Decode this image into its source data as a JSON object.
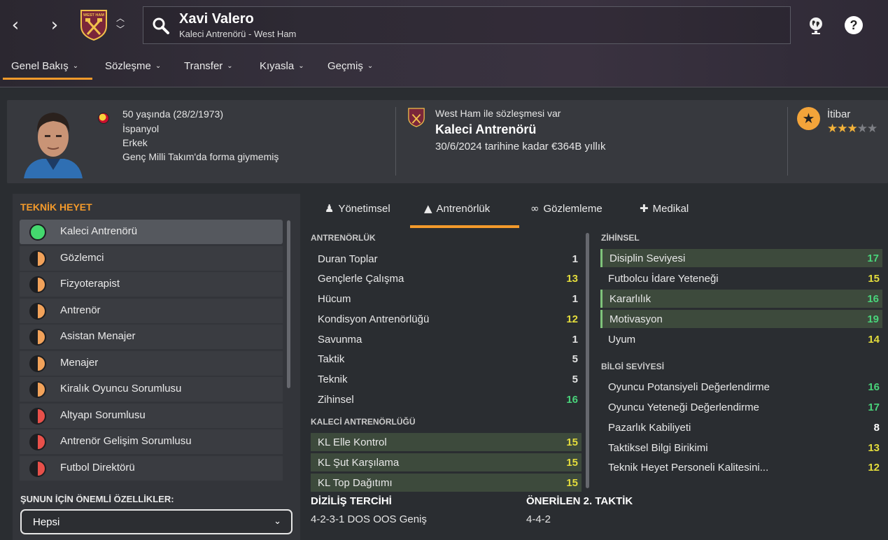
{
  "header": {
    "back_icon": "chevron-left",
    "forward_icon": "chevron-right",
    "club_crest": "west-ham-crest",
    "crest_text": "WEST HAM",
    "search": {
      "name": "Xavi Valero",
      "subtitle": "Kaleci Antrenörü - West Ham"
    },
    "right_icons": [
      "world-icon",
      "help-icon"
    ]
  },
  "menu": {
    "items": [
      "Genel Bakış",
      "Sözleşme",
      "Transfer",
      "Kıyasla",
      "Geçmiş"
    ],
    "active": 0
  },
  "profile": {
    "lines": [
      "50 yaşında (28/2/1973)",
      "İspanyol",
      "Erkek",
      "Genç Milli Takım'da forma giymemiş"
    ],
    "contract_text": "West Ham ile sözleşmesi var",
    "role": "Kaleci Antrenörü",
    "contract_value": "30/6/2024 tarihine kadar €364B yıllık",
    "reputation_label": "İtibar",
    "reputation_stars": 3
  },
  "staff_panel": {
    "title": "TEKNİK HEYET",
    "items": [
      {
        "label": "Kaleci Antrenörü",
        "status": "green"
      },
      {
        "label": "Gözlemci",
        "status": "orange"
      },
      {
        "label": "Fizyoterapist",
        "status": "orange"
      },
      {
        "label": "Antrenör",
        "status": "orange"
      },
      {
        "label": "Asistan Menajer",
        "status": "orange"
      },
      {
        "label": "Menajer",
        "status": "orange"
      },
      {
        "label": "Kiralık Oyuncu Sorumlusu",
        "status": "orange"
      },
      {
        "label": "Altyapı Sorumlusu",
        "status": "red"
      },
      {
        "label": "Antrenör Gelişim Sorumlusu",
        "status": "red"
      },
      {
        "label": "Futbol Direktörü",
        "status": "red"
      }
    ],
    "select_label": "ŞUNUN İÇİN ÖNEMLİ ÖZELLİKLER:",
    "select_value": "Hepsi"
  },
  "tabs": [
    {
      "label": "Yönetimsel",
      "icon": "person-icon"
    },
    {
      "label": "Antrenörlük",
      "icon": "cone-icon"
    },
    {
      "label": "Gözlemleme",
      "icon": "binoculars-icon"
    },
    {
      "label": "Medikal",
      "icon": "medkit-icon"
    }
  ],
  "coaching": {
    "title": "ANTRENÖRLÜK",
    "attrs": [
      {
        "name": "Duran Toplar",
        "value": "1"
      },
      {
        "name": "Gençlerle Çalışma",
        "value": "13"
      },
      {
        "name": "Hücum",
        "value": "1"
      },
      {
        "name": "Kondisyon Antrenörlüğü",
        "value": "12"
      },
      {
        "name": "Savunma",
        "value": "1"
      },
      {
        "name": "Taktik",
        "value": "5"
      },
      {
        "name": "Teknik",
        "value": "5"
      },
      {
        "name": "Zihinsel",
        "value": "16"
      }
    ]
  },
  "gk_coaching": {
    "title": "KALECİ ANTRENÖRLÜĞÜ",
    "attrs": [
      {
        "name": "KL Elle Kontrol",
        "value": "15"
      },
      {
        "name": "KL Şut Karşılama",
        "value": "15"
      },
      {
        "name": "KL Top Dağıtımı",
        "value": "15"
      }
    ]
  },
  "mental": {
    "title": "ZİHİNSEL",
    "attrs": [
      {
        "name": "Disiplin Seviyesi",
        "value": "17"
      },
      {
        "name": "Futbolcu İdare Yeteneği",
        "value": "15"
      },
      {
        "name": "Kararlılık",
        "value": "16"
      },
      {
        "name": "Motivasyon",
        "value": "19"
      },
      {
        "name": "Uyum",
        "value": "14"
      }
    ]
  },
  "knowledge": {
    "title": "BİLGİ SEVİYESİ",
    "attrs": [
      {
        "name": "Oyuncu Potansiyeli Değerlendirme",
        "value": "16"
      },
      {
        "name": "Oyuncu Yeteneği Değerlendirme",
        "value": "17"
      },
      {
        "name": "Pazarlık Kabiliyeti",
        "value": "8"
      },
      {
        "name": "Taktiksel Bilgi Birikimi",
        "value": "13"
      },
      {
        "name": "Teknik Heyet Personeli Kalitesini...",
        "value": "12"
      }
    ]
  },
  "footer": {
    "formation_title": "DİZİLİŞ TERCİHİ",
    "formation_value": "4-2-3-1 DOS OOS Geniş",
    "tactic_title": "ÖNERİLEN 2. TAKTİK",
    "tactic_value": "4-4-2"
  },
  "colors": {
    "accent": "#f39a2b",
    "green": "#49d47a",
    "yellow": "#e3dc3c",
    "orange_status": "#f2a25a",
    "red_status": "#e8504a"
  }
}
